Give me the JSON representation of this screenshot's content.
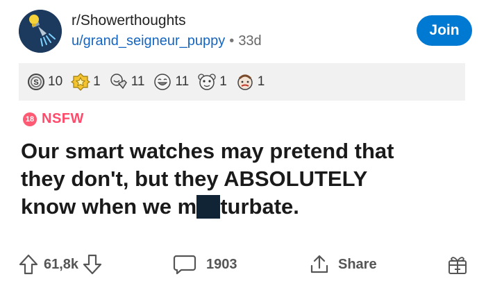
{
  "post": {
    "subreddit": "r/Showerthoughts",
    "user": "u/grand_seigneur_puppy",
    "separator": "•",
    "age": "33d",
    "join_label": "Join",
    "awards": [
      {
        "icon": "silver-award-icon",
        "count": "10"
      },
      {
        "icon": "gold-award-icon",
        "count": "1"
      },
      {
        "icon": "wholesome-award-icon",
        "count": "11"
      },
      {
        "icon": "laughing-award-icon",
        "count": "11"
      },
      {
        "icon": "bear-award-icon",
        "count": "1"
      },
      {
        "icon": "facepalm-award-icon",
        "count": "1"
      }
    ],
    "nsfw_badge": "18",
    "nsfw_label": "NSFW",
    "title_line1": "Our smart watches may pretend that",
    "title_line2": "they don't, but they ABSOLUTELY",
    "title_line3_a": "know when we m",
    "title_line3_b": "turbate.",
    "score": "61,8k",
    "comments": "1903",
    "share_label": "Share"
  },
  "colors": {
    "join_bg": "#0079d3",
    "nsfw": "#ff4b6b",
    "user_link": "#1565c0",
    "censor_box": "#102436"
  }
}
